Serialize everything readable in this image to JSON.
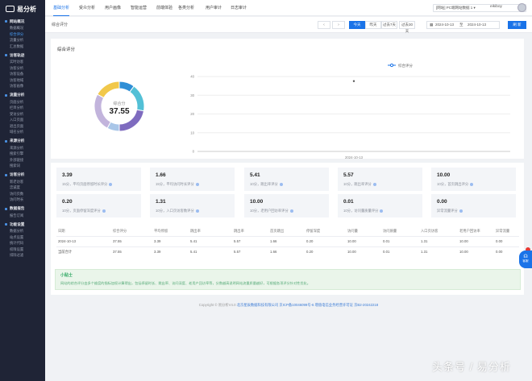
{
  "brand": {
    "name": "易分析"
  },
  "sidebar": {
    "groups": [
      {
        "title": "网站概况",
        "items": [
          "数据概况",
          "综合评分",
          "流量分析",
          "汇总数据"
        ],
        "active": 1
      },
      {
        "title": "访客轨迹",
        "items": [
          "实时访客",
          "访客分析",
          "访客设备",
          "访客地域",
          "访客画像"
        ],
        "active": -1
      },
      {
        "title": "流量分析",
        "items": [
          "页面分析",
          "栏目分析",
          "受访分析",
          "入口页面",
          "退出页面",
          "域名分析"
        ],
        "active": -1
      },
      {
        "title": "来源分析",
        "items": [
          "来源分析",
          "搜索引擎",
          "外部链接",
          "搜索词"
        ],
        "active": -1
      },
      {
        "title": "访客分析",
        "items": [
          "新老访客",
          "忠诚度",
          "访问页数",
          "访问时长"
        ],
        "active": -1
      },
      {
        "title": "数据报告",
        "items": [
          "报告订阅"
        ],
        "active": -1
      },
      {
        "title": "功能设置",
        "items": [
          "数据分析",
          "站点设置",
          "统计代码",
          "权限设置",
          "排除过滤"
        ],
        "active": -1
      }
    ]
  },
  "topbar": {
    "tabs": [
      "基础分析",
      "受众分析",
      "用户画像",
      "智能运营",
      "前端体验",
      "各类分析",
      "用户审计",
      "日志审计"
    ],
    "active_tab": 0,
    "site_select": "[网站] PC端网站数据 1",
    "user": "eikiboy"
  },
  "subbar": {
    "title": "综合评分",
    "ranges": [
      "今天",
      "昨天",
      "过去7天",
      "过去30天"
    ],
    "active_range": 0,
    "date_from": "2024-10-13",
    "date_sep": "至",
    "date_to": "2024-10-13",
    "refresh_label": "刷 新"
  },
  "colors": {
    "accent": "#1a73e8"
  },
  "score_card": {
    "title": "综合评分",
    "donut_label": "综合分",
    "score": "37.55",
    "segment_colors": [
      "#2f8fd6",
      "#53c0d6",
      "#7e6bbf",
      "#a9c6e8",
      "#c2b4dc",
      "#f1c84b"
    ],
    "segment_values": [
      10,
      18,
      22,
      8,
      25,
      17
    ]
  },
  "chart_data": {
    "type": "line",
    "legend": [
      "综合评分"
    ],
    "x": [
      "2024-10-13"
    ],
    "series": [
      {
        "name": "综合评分",
        "values": [
          37.55
        ]
      }
    ],
    "yticks": [
      0,
      10,
      20,
      30,
      40
    ],
    "ylim": [
      0,
      40
    ]
  },
  "metrics": [
    {
      "value": "3.39",
      "label": "15分，平均页面停留时长评分"
    },
    {
      "value": "1.66",
      "label": "15分，平均访问时长评分"
    },
    {
      "value": "5.41",
      "label": "10分，跳出率评分"
    },
    {
      "value": "5.57",
      "label": "10分，跳出率评分"
    },
    {
      "value": "10.00",
      "label": "10分，首页跳出评分"
    },
    {
      "value": "0.20",
      "label": "10分，页面停留深度评分"
    },
    {
      "value": "1.31",
      "label": "10分，入口页访客数评分"
    },
    {
      "value": "10.00",
      "label": "10分，老用户回访率评分"
    },
    {
      "value": "0.01",
      "label": "10分，访问量质量评分"
    },
    {
      "value": "0.00",
      "label": "异常流量评分"
    }
  ],
  "table": {
    "headers": [
      "日期",
      "综合评分",
      "平均停留",
      "跳出率",
      "跳出率",
      "首页跳出",
      "停留深度",
      "访问量",
      "访问质量",
      "入口页访客",
      "老用户回访率",
      "异常流量"
    ],
    "rows": [
      [
        "2024-10-13",
        "37.55",
        "3.39",
        "5.41",
        "5.57",
        "1.66",
        "0.20",
        "10.00",
        "0.01",
        "1.31",
        "10.00",
        "0.00"
      ],
      [
        "当前合计",
        "37.55",
        "3.39",
        "5.41",
        "5.57",
        "1.66",
        "0.20",
        "10.00",
        "0.01",
        "1.31",
        "10.00",
        "0.00"
      ]
    ]
  },
  "tip": {
    "title": "小贴士",
    "text": "网站的综合评分由多个维度的指标加权计算得出，包括停留时长、跳出率、访问深度、老用户回访率等，分数越高说明网站流量质量越好，可根据各项评分针对性优化。"
  },
  "footer": {
    "copyright": "Copyright © 易分析V4.0 ",
    "links": "北京星辰数据科技有限公司  京ICP备10046099号-6  增值电信业务经营许可证 京B2-20242218"
  },
  "float_button": {
    "label": "客服"
  },
  "watermark": "头条号 / 易分析"
}
